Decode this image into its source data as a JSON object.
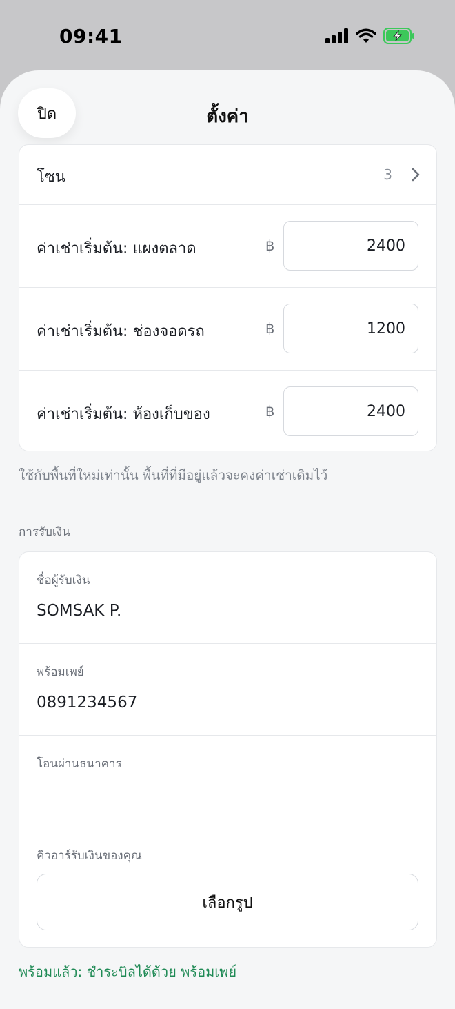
{
  "status_bar": {
    "time": "09:41",
    "battery_color": "#3cc85a"
  },
  "header": {
    "close_label": "ปิด",
    "title": "ตั้งค่า"
  },
  "zones": {
    "label": "โซน",
    "count": "3"
  },
  "rents": [
    {
      "label": "ค่าเช่าเริ่มต้น: แผงตลาด",
      "currency": "฿",
      "value": "2400"
    },
    {
      "label": "ค่าเช่าเริ่มต้น: ช่องจอดรถ",
      "currency": "฿",
      "value": "1200"
    },
    {
      "label": "ค่าเช่าเริ่มต้น: ห้องเก็บของ",
      "currency": "฿",
      "value": "2400"
    }
  ],
  "rent_note": "ใช้กับพื้นที่ใหม่เท่านั้น พื้นที่ที่มีอยู่แล้วจะคงค่าเช่าเดิมไว้",
  "payment": {
    "section_label": "การรับเงิน",
    "payee_label": "ชื่อผู้รับเงิน",
    "payee_value": "SOMSAK P.",
    "promptpay_label": "พร้อมเพย์",
    "promptpay_value": "0891234567",
    "bank_label": "โอนผ่านธนาคาร",
    "bank_value": "",
    "qr_label": "คิวอาร์รับเงินของคุณ",
    "choose_image_label": "เลือกรูป",
    "ready_text": "พร้อมแล้ว: ชำระบิลได้ด้วย พร้อมเพย์"
  },
  "colors": {
    "accent_green": "#1f8a55",
    "sheet_bg": "#f5f6f7",
    "backdrop": "#c7c7c9"
  }
}
